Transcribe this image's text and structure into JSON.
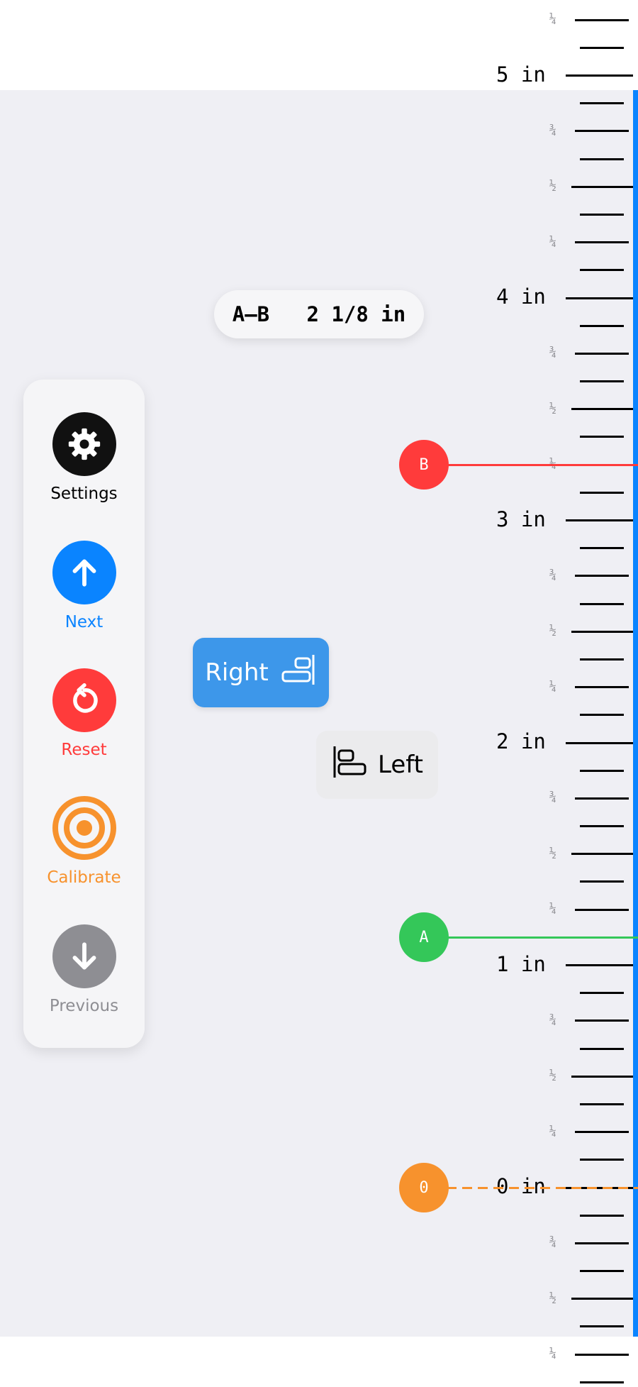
{
  "ruler": {
    "unit": "in",
    "inch_labels": [
      "0 in",
      "1 in",
      "2 in",
      "3 in",
      "4 in",
      "5 in"
    ],
    "fraction_labels": {
      "quarter": "¼",
      "half": "½",
      "three_quarter": "¾"
    },
    "accent_color": "#0a84ff"
  },
  "measurement": {
    "label": "A–B",
    "value": "2 1/8 in"
  },
  "markers": {
    "zero": {
      "label": "0",
      "color": "#f7922d",
      "line_style": "dashed",
      "position_in": 0
    },
    "a": {
      "label": "A",
      "color": "#34c759",
      "line_style": "solid",
      "position_in": 1.125
    },
    "b": {
      "label": "B",
      "color": "#ff3b3b",
      "line_style": "solid",
      "position_in": 3.25
    }
  },
  "toolbar": {
    "settings": {
      "label": "Settings",
      "icon": "gear-icon",
      "color": "#111111"
    },
    "next": {
      "label": "Next",
      "icon": "arrow-up-icon",
      "color": "#0a84ff"
    },
    "reset": {
      "label": "Reset",
      "icon": "reset-icon",
      "color": "#ff3b3b"
    },
    "calibrate": {
      "label": "Calibrate",
      "icon": "target-icon",
      "color": "#f7922d"
    },
    "previous": {
      "label": "Previous",
      "icon": "arrow-down-icon",
      "color": "#8e8e93"
    }
  },
  "alignment": {
    "right_label": "Right",
    "left_label": "Left",
    "selected": "right"
  }
}
